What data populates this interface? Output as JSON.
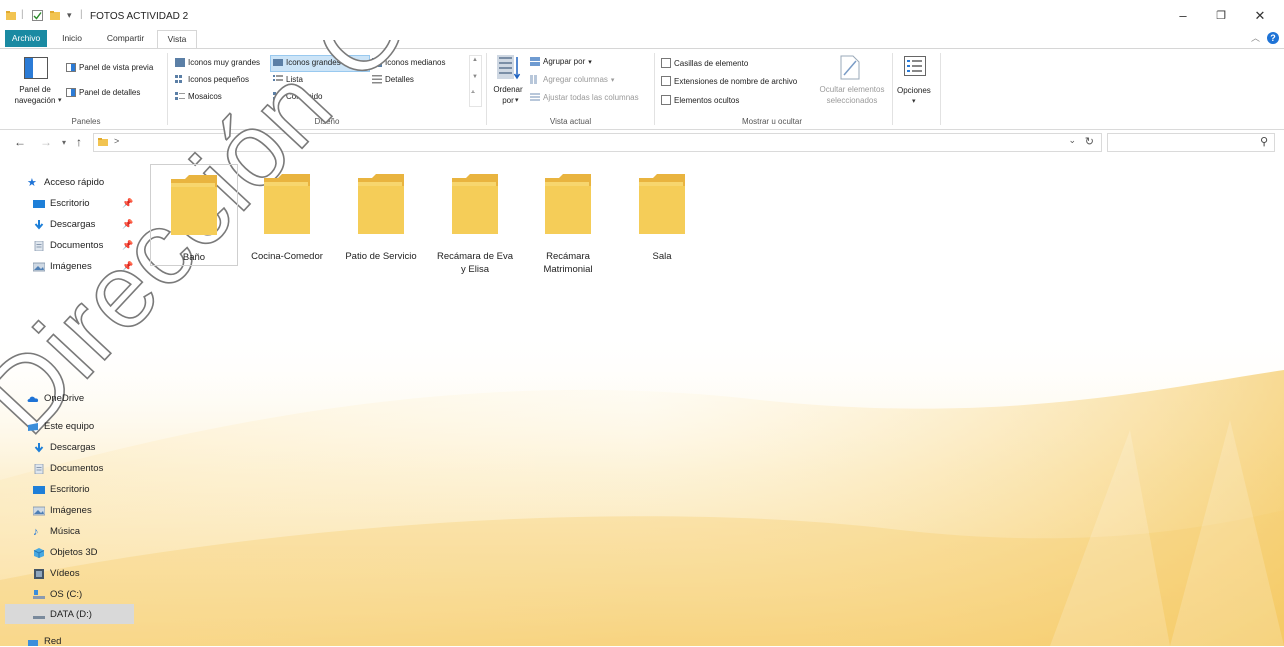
{
  "window": {
    "title": "FOTOS ACTIVIDAD 2",
    "controls": {
      "minimize": "–",
      "maximize": "❐",
      "close": "✕"
    }
  },
  "tabs": [
    {
      "label": "Archivo"
    },
    {
      "label": "Inicio"
    },
    {
      "label": "Compartir"
    },
    {
      "label": "Vista"
    }
  ],
  "ribbon": {
    "paneles": {
      "label": "Paneles",
      "nav_pane": "Panel de navegación",
      "preview_pane": "Panel de vista previa",
      "details_pane": "Panel de detalles"
    },
    "diseno": {
      "label": "Diseño",
      "items": [
        "Iconos muy grandes",
        "Iconos grandes",
        "Iconos medianos",
        "Iconos pequeños",
        "Lista",
        "Detalles",
        "Mosaicos",
        "Contenido"
      ],
      "selected": "Iconos grandes"
    },
    "vista_actual": {
      "label": "Vista actual",
      "sort": "Ordenar por",
      "group": "Agrupar por",
      "add_columns": "Agregar columnas",
      "fit_columns": "Ajustar todas las columnas"
    },
    "mostrar": {
      "label": "Mostrar u ocultar",
      "checkboxes": "Casillas de elemento",
      "extensions": "Extensiones de nombre de archivo",
      "hidden": "Elementos ocultos",
      "hide_selected": "Ocultar elementos seleccionados"
    },
    "opciones": "Opciones"
  },
  "address": {
    "path_sep": ">"
  },
  "sidebar": {
    "quick_access": "Acceso rápido",
    "quick_items": [
      "Escritorio",
      "Descargas",
      "Documentos",
      "Imágenes"
    ],
    "onedrive": "OneDrive",
    "this_pc": "Este equipo",
    "pc_items": [
      "Descargas",
      "Documentos",
      "Escritorio",
      "Imágenes",
      "Música",
      "Objetos 3D",
      "Vídeos",
      "OS (C:)",
      "DATA (D:)"
    ],
    "network": "Red",
    "selected": "DATA (D:)"
  },
  "folders": [
    {
      "name": "Baño"
    },
    {
      "name": "Cocina-Comedor"
    },
    {
      "name": "Patio de Servicio"
    },
    {
      "name": "Recámara de Eva y Elisa"
    },
    {
      "name": "Recámara Matrimonial"
    },
    {
      "name": "Sala"
    }
  ],
  "watermark": "Dirección General",
  "colors": {
    "file_tab": "#1a8aa2",
    "folder": "#f5cd58",
    "selection": "#cce4f7",
    "help": "#1e73d6"
  }
}
